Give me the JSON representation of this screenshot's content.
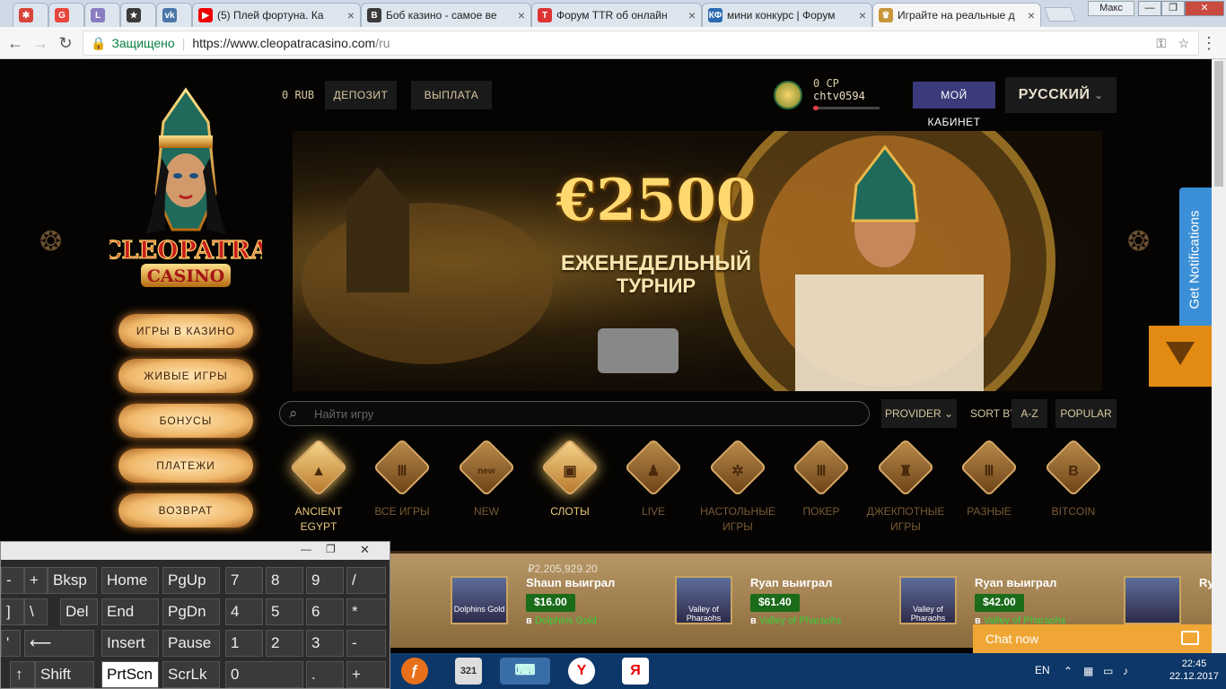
{
  "browser": {
    "tabs": [
      {
        "title": "",
        "fav": "✱",
        "color": "#d9443a"
      },
      {
        "title": "",
        "fav": "G",
        "color": "#e8453c"
      },
      {
        "title": "",
        "fav": "L",
        "color": "#8a7cc0"
      },
      {
        "title": "",
        "fav": "★",
        "color": "#3a3a3a"
      },
      {
        "title": "",
        "fav": "vk",
        "color": "#4a76a8"
      },
      {
        "title": "(5) Плей фортуна. Ка",
        "fav": "▶",
        "color": "#e00"
      },
      {
        "title": "Боб казино - самое ве",
        "fav": "B",
        "color": "#3a3a3a"
      },
      {
        "title": "Форум TTR об онлайн",
        "fav": "T",
        "color": "#d33"
      },
      {
        "title": "мини конкурс | Форум",
        "fav": "КФ",
        "color": "#2b6bb0"
      },
      {
        "title": "Играйте на реальные д",
        "fav": "♛",
        "color": "#c7953a"
      }
    ],
    "profile": "Макс",
    "secure_label": "Защищено",
    "url_host": "https://www.cleopatracasino.com",
    "url_path": "/ru"
  },
  "header": {
    "balance": "0 RUB",
    "deposit": "ДЕПОЗИТ",
    "withdraw": "ВЫПЛАТА",
    "points": "0 CP",
    "username": "chtv0594",
    "cabinet": "МОЙ КАБИНЕТ",
    "language": "РУССКИЙ"
  },
  "logo": {
    "line1": "CLEOPATRA",
    "line2": "CASINO"
  },
  "sidebar": {
    "items": [
      "ИГРЫ В КАЗИНО",
      "ЖИВЫЕ ИГРЫ",
      "БОНУСЫ",
      "ПЛАТЕЖИ",
      "ВОЗВРАТ"
    ]
  },
  "banner": {
    "amount": "€2500",
    "line1": "ЕЖЕНЕДЕЛЬНЫЙ",
    "line2": "ТУРНИР"
  },
  "search": {
    "placeholder": "Найти игру"
  },
  "filters": {
    "provider": "PROVIDER",
    "sort_by": "SORT BY",
    "az": "A-Z",
    "popular": "POPULAR"
  },
  "categories": [
    {
      "label": "ANCIENT EGYPT",
      "icon": "pyramid-icon",
      "glyph": "▲",
      "active": true
    },
    {
      "label": "ВСЕ ИГРЫ",
      "icon": "column-icon",
      "glyph": "Ⅲ",
      "active": false
    },
    {
      "label": "NEW",
      "icon": "new-icon",
      "glyph": "new",
      "active": false
    },
    {
      "label": "СЛОТЫ",
      "icon": "slot-icon",
      "glyph": "▣",
      "active": true
    },
    {
      "label": "LIVE",
      "icon": "dealer-icon",
      "glyph": "♟",
      "active": false
    },
    {
      "label": "НАСТОЛЬНЫЕ ИГРЫ",
      "icon": "roulette-icon",
      "glyph": "✲",
      "active": false
    },
    {
      "label": "ПОКЕР",
      "icon": "column-icon",
      "glyph": "Ⅲ",
      "active": false
    },
    {
      "label": "ДЖЕКПОТНЫЕ ИГРЫ",
      "icon": "trophy-icon",
      "glyph": "♜",
      "active": false
    },
    {
      "label": "РАЗНЫЕ",
      "icon": "column-icon",
      "glyph": "Ⅲ",
      "active": false
    },
    {
      "label": "BITCOIN",
      "icon": "bitcoin-icon",
      "glyph": "B",
      "active": false
    }
  ],
  "ticker": {
    "jackpot": "₽2,205,929.20",
    "wins": [
      {
        "name": "Shaun выиграл",
        "amount": "$16.00",
        "in": "в",
        "game": "Dolphins Gold"
      },
      {
        "name": "Ryan выиграл",
        "amount": "$61.40",
        "in": "в",
        "game": "Valley of Pharaohs"
      },
      {
        "name": "Ryan выиграл",
        "amount": "$42.00",
        "in": "в",
        "game": "Valley of Pharaohs"
      },
      {
        "name": "Ry",
        "amount": "",
        "in": "",
        "game": ""
      }
    ]
  },
  "notifications": "Get Notifications",
  "chat": "Chat now",
  "keyboard": {
    "keys": [
      "-",
      "+ =",
      "Bksp",
      "Home",
      "PgUp",
      "7",
      "8",
      "9",
      "/",
      "]",
      "\\",
      "Del",
      "End",
      "PgDn",
      "4",
      "5",
      "6",
      "*",
      "'",
      "⟵",
      "Insert",
      "Pause",
      "1",
      "2",
      "3",
      "-",
      "↑",
      "Shift",
      "PrtScn",
      "ScrLk",
      "0",
      ".",
      "+"
    ]
  },
  "taskbar": {
    "lang": "EN",
    "time": "22:45",
    "date": "22.12.2017"
  }
}
